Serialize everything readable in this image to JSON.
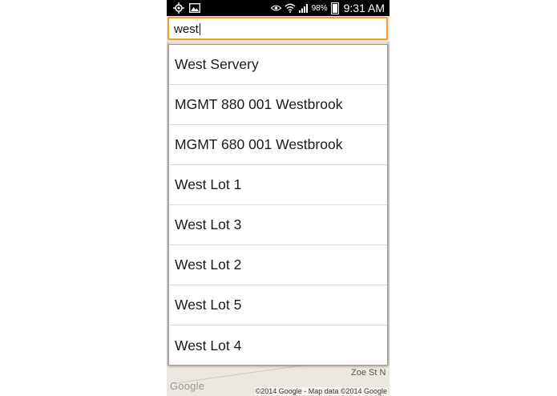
{
  "status_bar": {
    "battery": "98%",
    "time": "9:31 AM"
  },
  "icons": {
    "location": "location-icon",
    "gallery": "image-icon",
    "eye": "eye-icon",
    "wifi": "wifi-icon",
    "signal": "signal-icon",
    "battery": "battery-icon"
  },
  "colors": {
    "focus_border": "#f0a030",
    "status_bar": "#000000"
  },
  "search": {
    "value": "west"
  },
  "suggestions": [
    "West Servery",
    "MGMT 880 001 Westbrook",
    "MGMT 680 001 Westbrook",
    "West Lot 1",
    "West Lot 3",
    "West Lot 2",
    "West Lot 5",
    "West Lot 4"
  ],
  "map": {
    "street_label": "Zoe St N",
    "logo": "Google",
    "attribution": "©2014 Google - Map data ©2014 Google"
  }
}
